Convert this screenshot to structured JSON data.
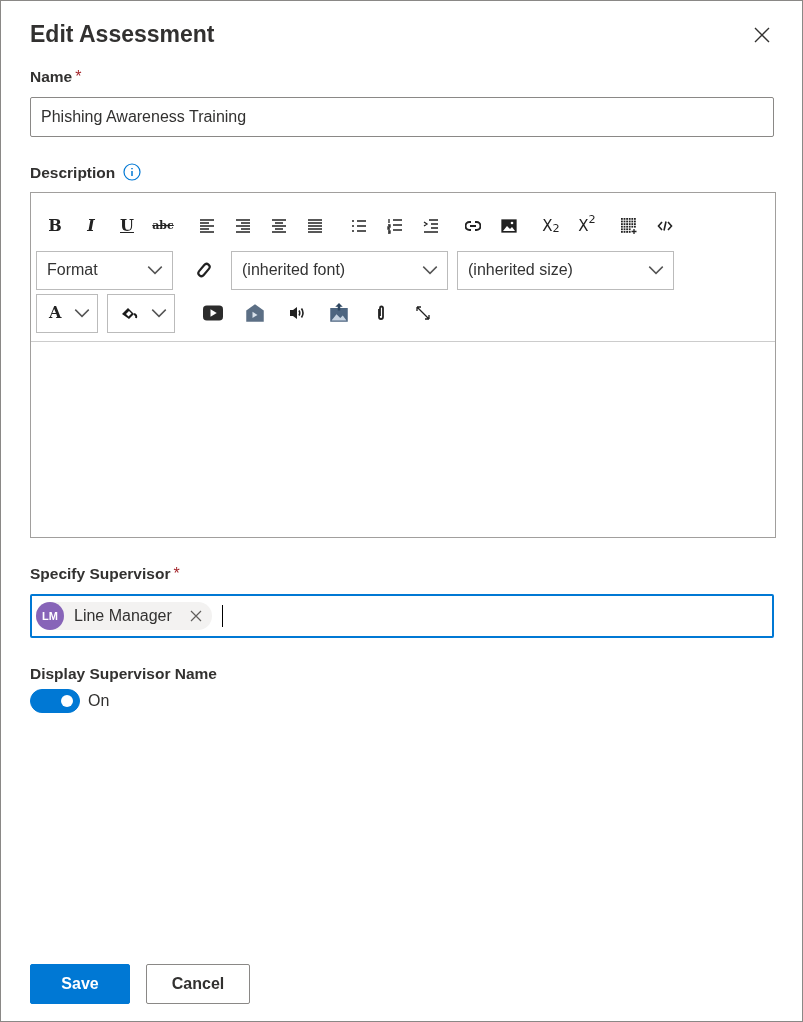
{
  "dialog": {
    "title": "Edit Assessment"
  },
  "name_field": {
    "label": "Name",
    "required_mark": "*",
    "value": "Phishing Awareness Training"
  },
  "description": {
    "label": "Description",
    "toolbar": [
      [
        {
          "kind": "bold",
          "label": "B"
        },
        {
          "kind": "italic",
          "label": "I"
        },
        {
          "kind": "underline",
          "label": "U"
        },
        {
          "kind": "strikethrough",
          "label": "abc"
        },
        {
          "kind": "align-left"
        },
        {
          "kind": "align-right"
        },
        {
          "kind": "align-center"
        },
        {
          "kind": "justify"
        },
        {
          "kind": "bullet-list"
        },
        {
          "kind": "numbered-list"
        },
        {
          "kind": "indent"
        },
        {
          "kind": "link"
        },
        {
          "kind": "image"
        },
        {
          "kind": "subscript",
          "label": "X$_{2}$"
        },
        {
          "kind": "superscript",
          "label": "X$^{2}$"
        },
        {
          "kind": "table"
        },
        {
          "kind": "code"
        }
      ],
      [
        {
          "kind": "select",
          "value": "Format"
        },
        {
          "kind": "clear-format"
        },
        {
          "kind": "select",
          "value": "(inherited font)"
        },
        {
          "kind": "select",
          "value": "(inherited size)"
        }
      ],
      [
        {
          "kind": "color-select",
          "label": "A"
        },
        {
          "kind": "highlight-select"
        },
        {
          "kind": "video"
        },
        {
          "kind": "embed-video"
        },
        {
          "kind": "audio"
        },
        {
          "kind": "upload-image"
        },
        {
          "kind": "attach"
        },
        {
          "kind": "fullscreen"
        }
      ]
    ]
  },
  "supervisor": {
    "label": "Specify Supervisor",
    "required_mark": "*",
    "focused": true,
    "chips": [
      {
        "initials": "LM",
        "name": "Line Manager"
      }
    ]
  },
  "display_toggle": {
    "label": "Display Supervisor Name",
    "on": true,
    "state_text": "On"
  },
  "buttons": [
    {
      "kind": "primary",
      "label": "Save"
    },
    {
      "kind": "secondary",
      "label": "Cancel"
    }
  ]
}
